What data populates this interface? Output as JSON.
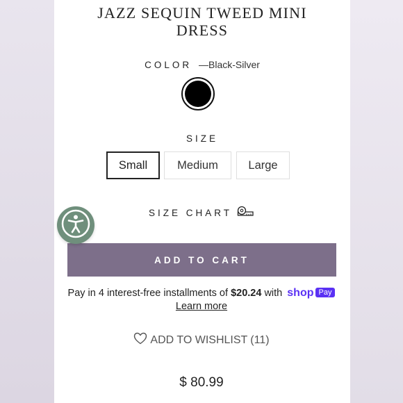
{
  "product": {
    "title_line1": "JAZZ SEQUIN TWEED MINI",
    "title_line2": "DRESS",
    "price": "$ 80.99"
  },
  "color": {
    "label": "COLOR",
    "value": "—Black-Silver",
    "swatch_color": "#000000"
  },
  "size": {
    "label": "SIZE",
    "options": [
      "Small",
      "Medium",
      "Large"
    ],
    "selected": "Small"
  },
  "size_chart": {
    "label": "SIZE CHART",
    "icon": "measuring-tape-icon"
  },
  "cart": {
    "button_label": "ADD TO CART",
    "button_color": "#7d6f8a"
  },
  "installments": {
    "prefix": "Pay in 4 interest-free installments of",
    "amount": "$20.24",
    "suffix": "with",
    "shop_logo": "shop",
    "pay_badge": "Pay",
    "learn_more": "Learn more",
    "brand_color": "#5a31f4"
  },
  "wishlist": {
    "label": "ADD TO WISHLIST",
    "count": "(11)",
    "icon": "heart-icon"
  },
  "accessibility": {
    "icon": "accessibility-icon",
    "color": "#6f8f7c"
  }
}
